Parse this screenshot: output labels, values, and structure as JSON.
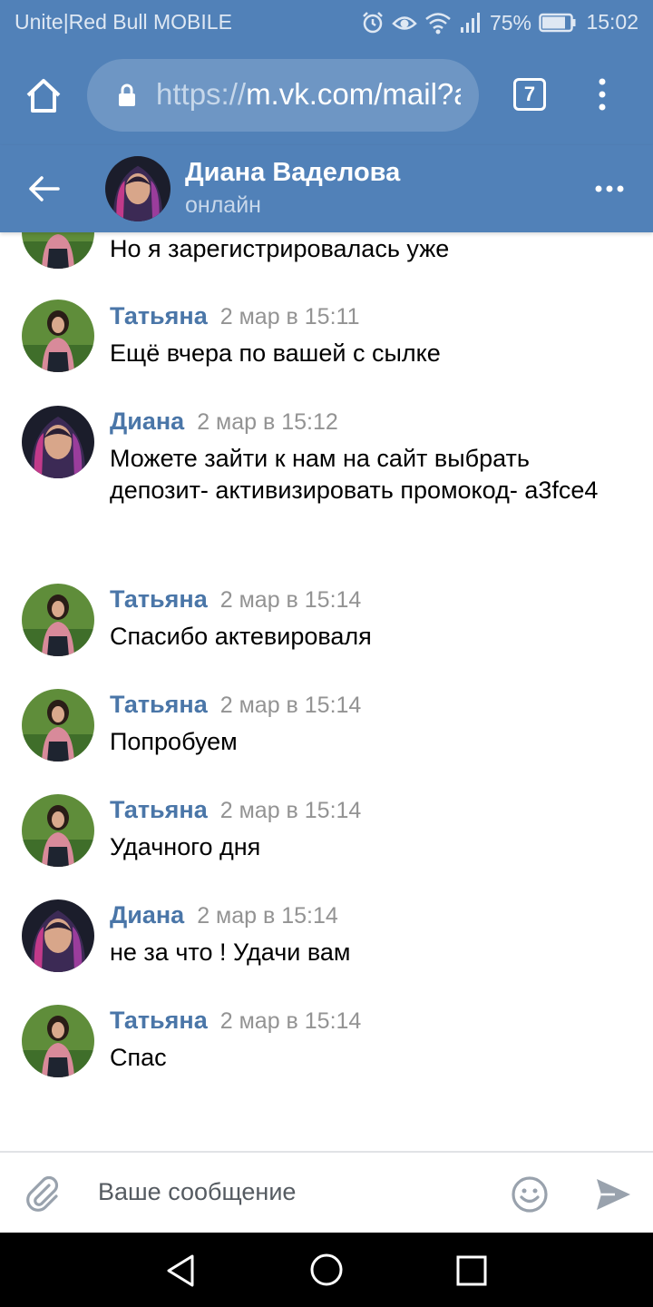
{
  "status_bar": {
    "carrier": "Unite|Red Bull MOBILE",
    "battery_percent": "75%",
    "time": "15:02",
    "icons": [
      "alarm-icon",
      "eye-icon",
      "wifi-icon",
      "signal-icon",
      "battery-icon"
    ]
  },
  "browser": {
    "url_scheme": "https://",
    "url_rest": "m.vk.com/mail?a",
    "tab_count": "7"
  },
  "chat": {
    "name": "Диана Ваделова",
    "status": "онлайн"
  },
  "messages": [
    {
      "author": "",
      "date": "",
      "text": "Но я зарегистрировалась уже",
      "avatar": "tatyana"
    },
    {
      "author": "Татьяна",
      "date": "2 мар в 15:11",
      "text": "Ещё вчера по вашей с сылке",
      "avatar": "tatyana"
    },
    {
      "author": "Диана",
      "date": "2 мар в 15:12",
      "text": "Можете зайти к нам на сайт выбрать депозит- активизировать промокод- a3fce4",
      "avatar": "diana"
    },
    {
      "author": "Татьяна",
      "date": "2 мар в 15:14",
      "text": "Спасибо актевироваля",
      "avatar": "tatyana"
    },
    {
      "author": "Татьяна",
      "date": "2 мар в 15:14",
      "text": "Попробуем",
      "avatar": "tatyana"
    },
    {
      "author": "Татьяна",
      "date": "2 мар в 15:14",
      "text": "Удачного дня",
      "avatar": "tatyana"
    },
    {
      "author": "Диана",
      "date": "2 мар в 15:14",
      "text": "не за что ! Удачи вам",
      "avatar": "diana"
    },
    {
      "author": "Татьяна",
      "date": "2 мар в 15:14",
      "text": "Спас",
      "avatar": "tatyana"
    }
  ],
  "composer": {
    "placeholder": "Ваше сообщение",
    "value": ""
  },
  "colors": {
    "header_bg": "#5181b8",
    "author_link": "#4a76a8",
    "date_gray": "#939393"
  }
}
